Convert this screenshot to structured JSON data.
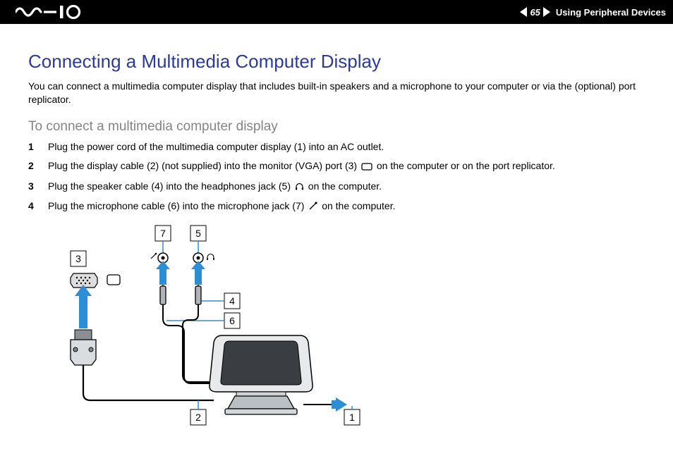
{
  "header": {
    "page_number": "65",
    "section": "Using Peripheral Devices"
  },
  "title": "Connecting a Multimedia Computer Display",
  "intro": "You can connect a multimedia computer display that includes built-in speakers and a microphone to your computer or via the (optional) port replicator.",
  "subheading": "To connect a multimedia computer display",
  "steps": [
    {
      "n": "1",
      "text": "Plug the power cord of the multimedia computer display (1) into an AC outlet."
    },
    {
      "n": "2",
      "text_pre": "Plug the display cable (2) (not supplied) into the monitor (VGA) port (3) ",
      "text_post": " on the computer or on the port replicator."
    },
    {
      "n": "3",
      "text_pre": "Plug the speaker cable (4) into the headphones jack (5) ",
      "text_post": " on the computer."
    },
    {
      "n": "4",
      "text_pre": "Plug the microphone cable (6) into the microphone jack (7) ",
      "text_post": " on the computer."
    }
  ],
  "diagram_labels": {
    "l1": "1",
    "l2": "2",
    "l3": "3",
    "l4": "4",
    "l5": "5",
    "l6": "6",
    "l7": "7"
  }
}
